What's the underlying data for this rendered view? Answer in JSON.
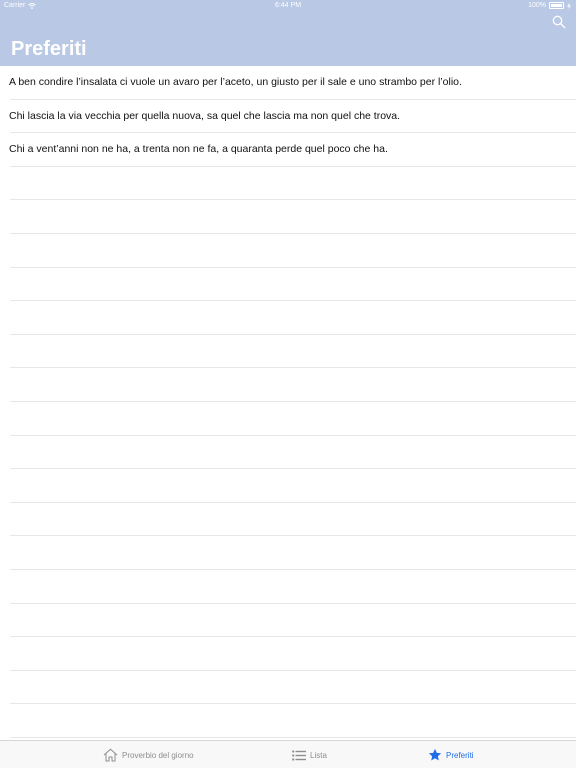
{
  "status_bar": {
    "carrier": "Carrier",
    "time": "6:44 PM",
    "battery": "100%"
  },
  "header": {
    "title": "Preferiti"
  },
  "favorites": [
    "A ben condire l’insalata ci vuole un avaro per l’aceto, un giusto per il sale e uno strambo per l’olio.",
    "Chi lascia la via vecchia per quella nuova, sa quel che lascia ma non quel che trova.",
    "Chi a vent’anni non ne ha, a trenta non ne fa, a quaranta perde quel poco che ha."
  ],
  "tabbar": {
    "tabs": [
      {
        "label": "Proverbio del giorno",
        "icon": "home-icon",
        "active": false
      },
      {
        "label": "Lista",
        "icon": "list-icon",
        "active": false
      },
      {
        "label": "Preferiti",
        "icon": "star-icon",
        "active": true
      }
    ]
  },
  "colors": {
    "header_bg": "#b9c8e4",
    "accent": "#1f6ee8",
    "inactive": "#8e8e8e"
  }
}
